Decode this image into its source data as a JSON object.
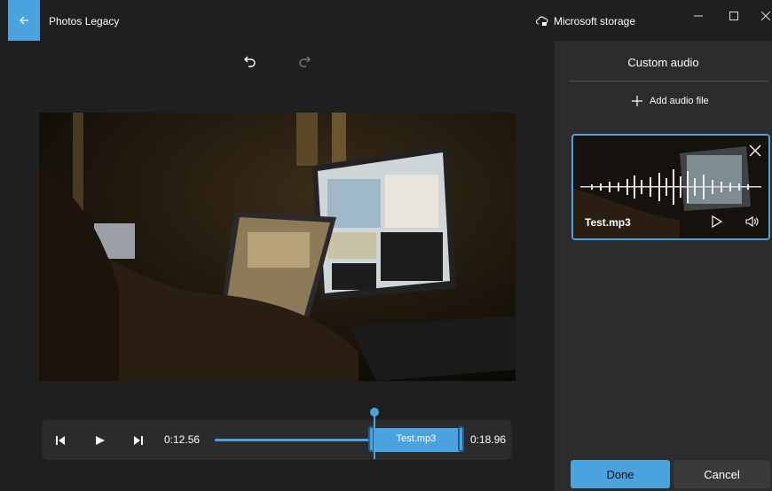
{
  "app": {
    "title": "Photos Legacy",
    "storage_label": "Microsoft storage"
  },
  "colors": {
    "accent": "#4aa3df",
    "background": "#1f1f1f",
    "panel": "#2c2c2c"
  },
  "toolbar": {
    "undo_icon": "undo-icon",
    "redo_icon": "redo-icon"
  },
  "scrubber": {
    "current_time": "0:12.56",
    "end_time": "0:18.96",
    "clip_label": "Test.mp3"
  },
  "panel": {
    "title": "Custom audio",
    "add_audio_label": "Add audio file",
    "audio_items": [
      {
        "name": "Test.mp3"
      }
    ],
    "done_label": "Done",
    "cancel_label": "Cancel"
  }
}
